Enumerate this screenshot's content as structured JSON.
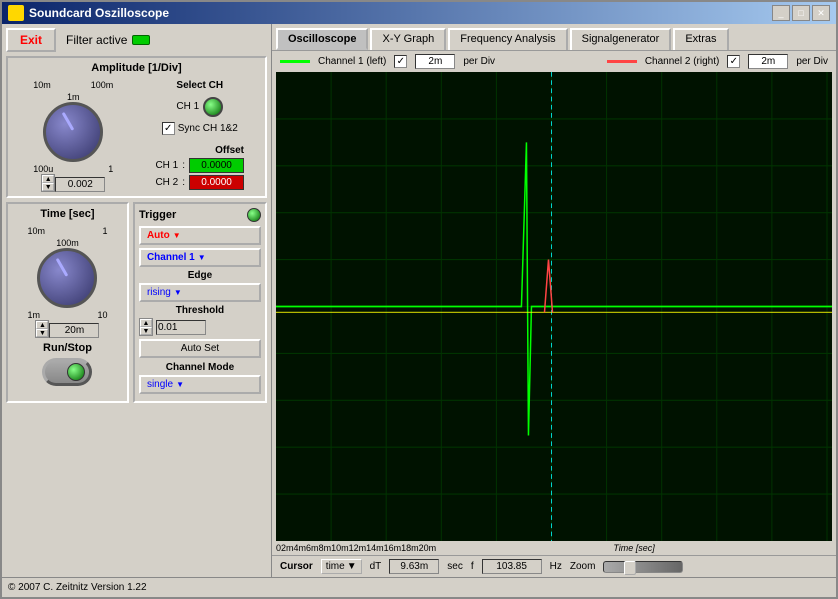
{
  "window": {
    "title": "Soundcard Oszilloscope",
    "minimize_label": "_",
    "maximize_label": "□",
    "close_label": "✕"
  },
  "left_panel": {
    "exit_button": "Exit",
    "filter_active_label": "Filter active"
  },
  "amplitude": {
    "title": "Amplitude [1/Div]",
    "labels": {
      "top_left": "10m",
      "top_right": "100m",
      "bottom_left": "100u",
      "bottom_right": "1",
      "center_top": "1m"
    },
    "value": "0.002",
    "select_ch_label": "Select CH",
    "ch1_label": "CH 1",
    "sync_label": "Sync CH 1&2",
    "offset_label": "Offset",
    "ch1_offset": "0.0000",
    "ch2_offset": "0.0000"
  },
  "time": {
    "title": "Time [sec]",
    "labels": {
      "top_left": "10m",
      "top_right": "1",
      "bottom_left": "1m",
      "bottom_right": "10",
      "center_top": "100m"
    },
    "value": "20m"
  },
  "trigger": {
    "title": "Trigger",
    "auto_label": "Auto",
    "channel_label": "Channel 1",
    "edge_label": "Edge",
    "rising_label": "rising",
    "threshold_label": "Threshold",
    "threshold_value": "0.01",
    "auto_set_label": "Auto Set",
    "channel_mode_label": "Channel Mode",
    "channel_mode_value": "single"
  },
  "run_stop": {
    "label": "Run/Stop"
  },
  "footer": {
    "copyright": "© 2007  C. Zeitnitz  Version 1.22"
  },
  "tabs": [
    {
      "id": "oscilloscope",
      "label": "Oscilloscope"
    },
    {
      "id": "xy-graph",
      "label": "X-Y Graph"
    },
    {
      "id": "frequency",
      "label": "Frequency Analysis"
    },
    {
      "id": "signalgenerator",
      "label": "Signalgenerator"
    },
    {
      "id": "extras",
      "label": "Extras"
    }
  ],
  "channels": {
    "ch1": {
      "label": "Channel 1 (left)",
      "per_div": "2m",
      "per_div_unit": "per Div"
    },
    "ch2": {
      "label": "Channel 2 (right)",
      "per_div": "2m",
      "per_div_unit": "per Div"
    }
  },
  "time_axis": {
    "labels": [
      "0",
      "2m",
      "4m",
      "6m",
      "8m",
      "10m",
      "12m",
      "14m",
      "16m",
      "18m",
      "20m"
    ],
    "unit_label": "Time [sec]"
  },
  "cursor": {
    "label": "Cursor",
    "type": "time",
    "dt_label": "dT",
    "dt_value": "9.63m",
    "dt_unit": "sec",
    "f_label": "f",
    "f_value": "103.85",
    "f_unit": "Hz",
    "zoom_label": "Zoom"
  }
}
